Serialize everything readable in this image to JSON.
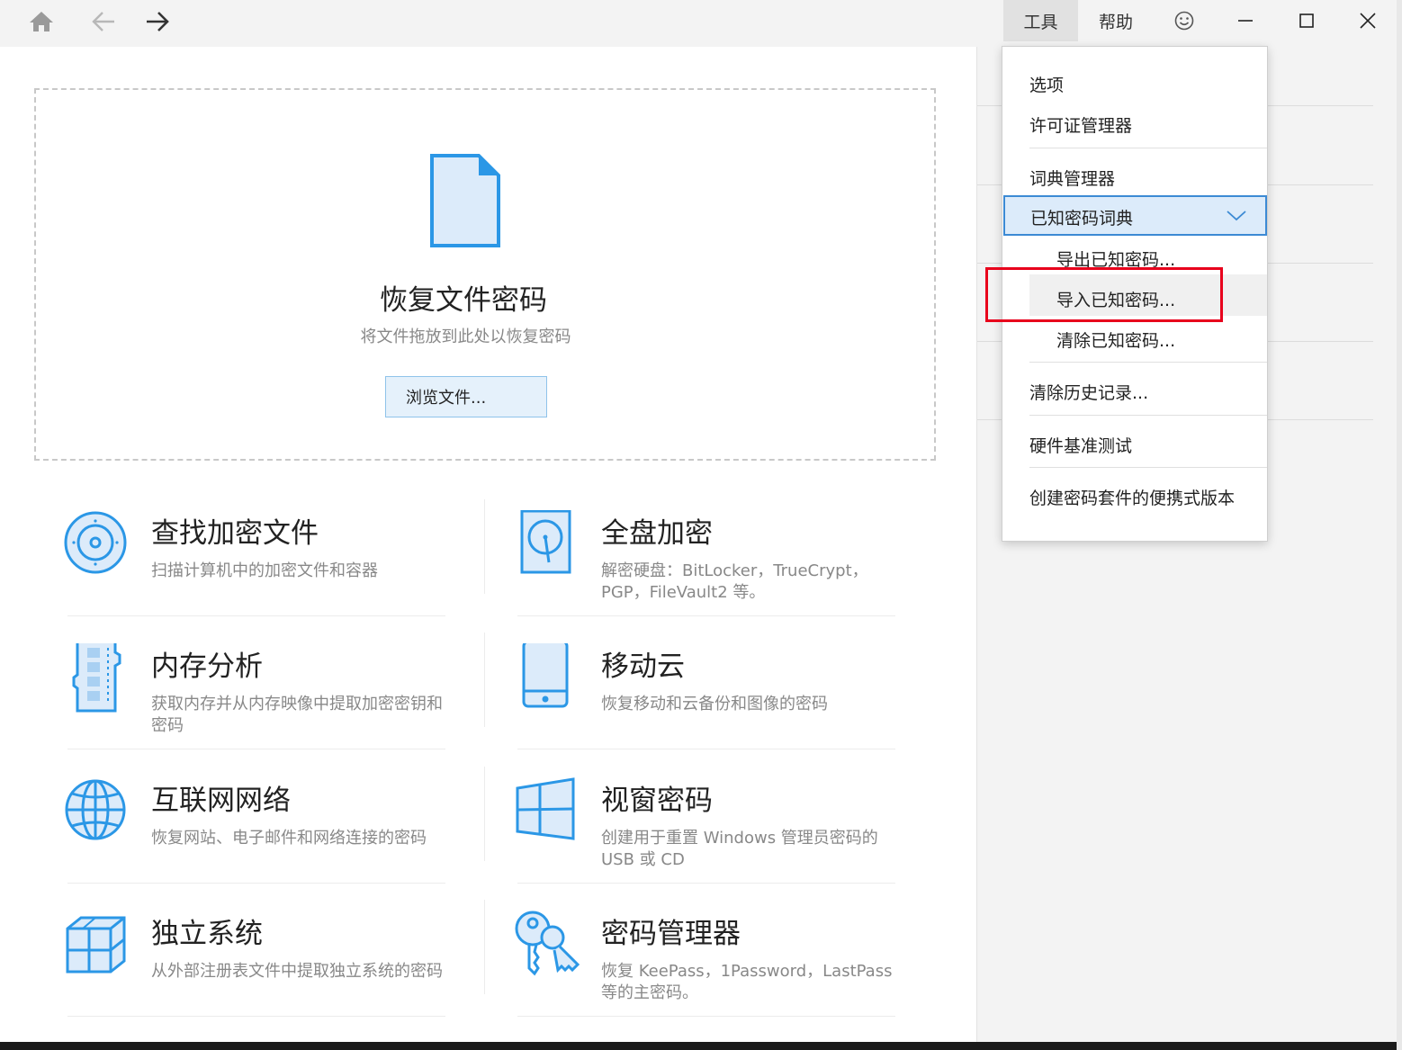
{
  "titlebar": {
    "menus": [
      {
        "label": "工具",
        "active": true
      },
      {
        "label": "帮助",
        "active": false
      }
    ],
    "icons": [
      "home-icon",
      "back-arrow-icon",
      "forward-arrow-icon",
      "feedback-smiley-icon",
      "minimize-icon",
      "maximize-icon",
      "close-icon"
    ]
  },
  "dropzone": {
    "title": "恢复文件密码",
    "subtitle": "将文件拖放到此处以恢复密码",
    "browse_label": "浏览文件..."
  },
  "features": [
    {
      "title": "查找加密文件",
      "desc": "扫描计算机中的加密文件和容器",
      "icon": "disc-search-icon"
    },
    {
      "title": "全盘加密",
      "desc": "解密硬盘：BitLocker，TrueCrypt，PGP，FileVault2 等。",
      "icon": "hard-disk-icon"
    },
    {
      "title": "内存分析",
      "desc": "获取内存并从内存映像中提取加密密钥和密码",
      "icon": "memory-module-icon"
    },
    {
      "title": "移动云",
      "desc": "恢复移动和云备份和图像的密码",
      "icon": "mobile-phone-icon"
    },
    {
      "title": "互联网网络",
      "desc": "恢复网站、电子邮件和网络连接的密码",
      "icon": "globe-icon"
    },
    {
      "title": "视窗密码",
      "desc": "创建用于重置 Windows 管理员密码的 USB 或 CD",
      "icon": "windows-icon"
    },
    {
      "title": "独立系统",
      "desc": "从外部注册表文件中提取独立系统的密码",
      "icon": "cubes-icon"
    },
    {
      "title": "密码管理器",
      "desc": "恢复 KeePass，1Password，LastPass 等的主密码。",
      "icon": "keys-icon"
    }
  ],
  "dropdown": {
    "options": "选项",
    "license_manager": "许可证管理器",
    "dictionary_manager": "词典管理器",
    "known_password_dictionary": "已知密码词典",
    "export_known": "导出已知密码...",
    "import_known": "导入已知密码...",
    "clear_known": "清除已知密码...",
    "clear_history": "清除历史记录...",
    "hardware_benchmark": "硬件基准测试",
    "create_portable": "创建密码套件的便携式版本"
  },
  "colors": {
    "accent_blue": "#2b97e6",
    "icon_fill": "#dcebfa",
    "highlight_red": "#e8001c",
    "selected_border": "#3c8ad4"
  }
}
